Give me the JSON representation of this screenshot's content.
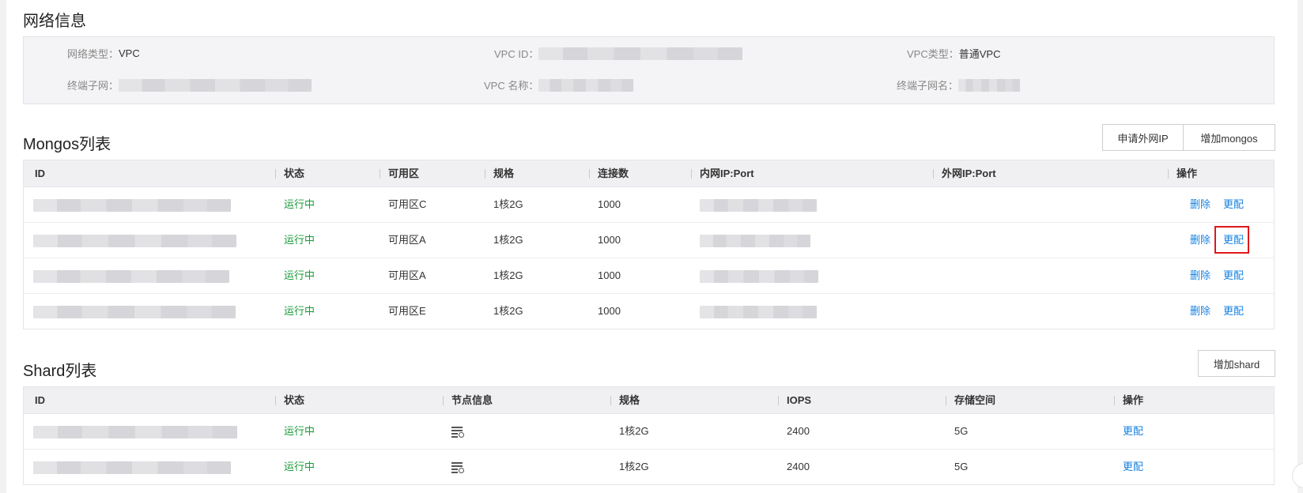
{
  "network_section": {
    "title": "网络信息",
    "fields": [
      {
        "label": "网络类型：",
        "value": "VPC"
      },
      {
        "label": "VPC ID：",
        "value": ""
      },
      {
        "label": "VPC类型：",
        "value": "普通VPC"
      },
      {
        "label": "终端子网：",
        "value": ""
      },
      {
        "label": "VPC 名称：",
        "value": ""
      },
      {
        "label": "终端子网名：",
        "value": ""
      }
    ]
  },
  "mongos_section": {
    "title": "Mongos列表",
    "buttons": {
      "apply_public_ip": "申请外网IP",
      "add_mongos": "增加mongos"
    },
    "columns": [
      "ID",
      "状态",
      "可用区",
      "规格",
      "连接数",
      "内网IP:Port",
      "外网IP:Port",
      "操作"
    ],
    "rows": [
      {
        "status": "运行中",
        "zone": "可用区C",
        "spec": "1核2G",
        "connections": "1000",
        "delete": "删除",
        "reconfig": "更配"
      },
      {
        "status": "运行中",
        "zone": "可用区A",
        "spec": "1核2G",
        "connections": "1000",
        "delete": "删除",
        "reconfig": "更配"
      },
      {
        "status": "运行中",
        "zone": "可用区A",
        "spec": "1核2G",
        "connections": "1000",
        "delete": "删除",
        "reconfig": "更配"
      },
      {
        "status": "运行中",
        "zone": "可用区E",
        "spec": "1核2G",
        "connections": "1000",
        "delete": "删除",
        "reconfig": "更配"
      }
    ]
  },
  "shard_section": {
    "title": "Shard列表",
    "buttons": {
      "add_shard": "增加shard"
    },
    "columns": [
      "ID",
      "状态",
      "节点信息",
      "规格",
      "IOPS",
      "存储空间",
      "操作"
    ],
    "rows": [
      {
        "status": "运行中",
        "node_icon": "node-detail-icon",
        "spec": "1核2G",
        "iops": "2400",
        "storage": "5G",
        "reconfig": "更配"
      },
      {
        "status": "运行中",
        "node_icon": "node-detail-icon",
        "spec": "1核2G",
        "iops": "2400",
        "storage": "5G",
        "reconfig": "更配"
      }
    ]
  },
  "colors": {
    "status_running": "#1a9a3a",
    "link": "#1782e0",
    "highlight": "#e0171b"
  }
}
